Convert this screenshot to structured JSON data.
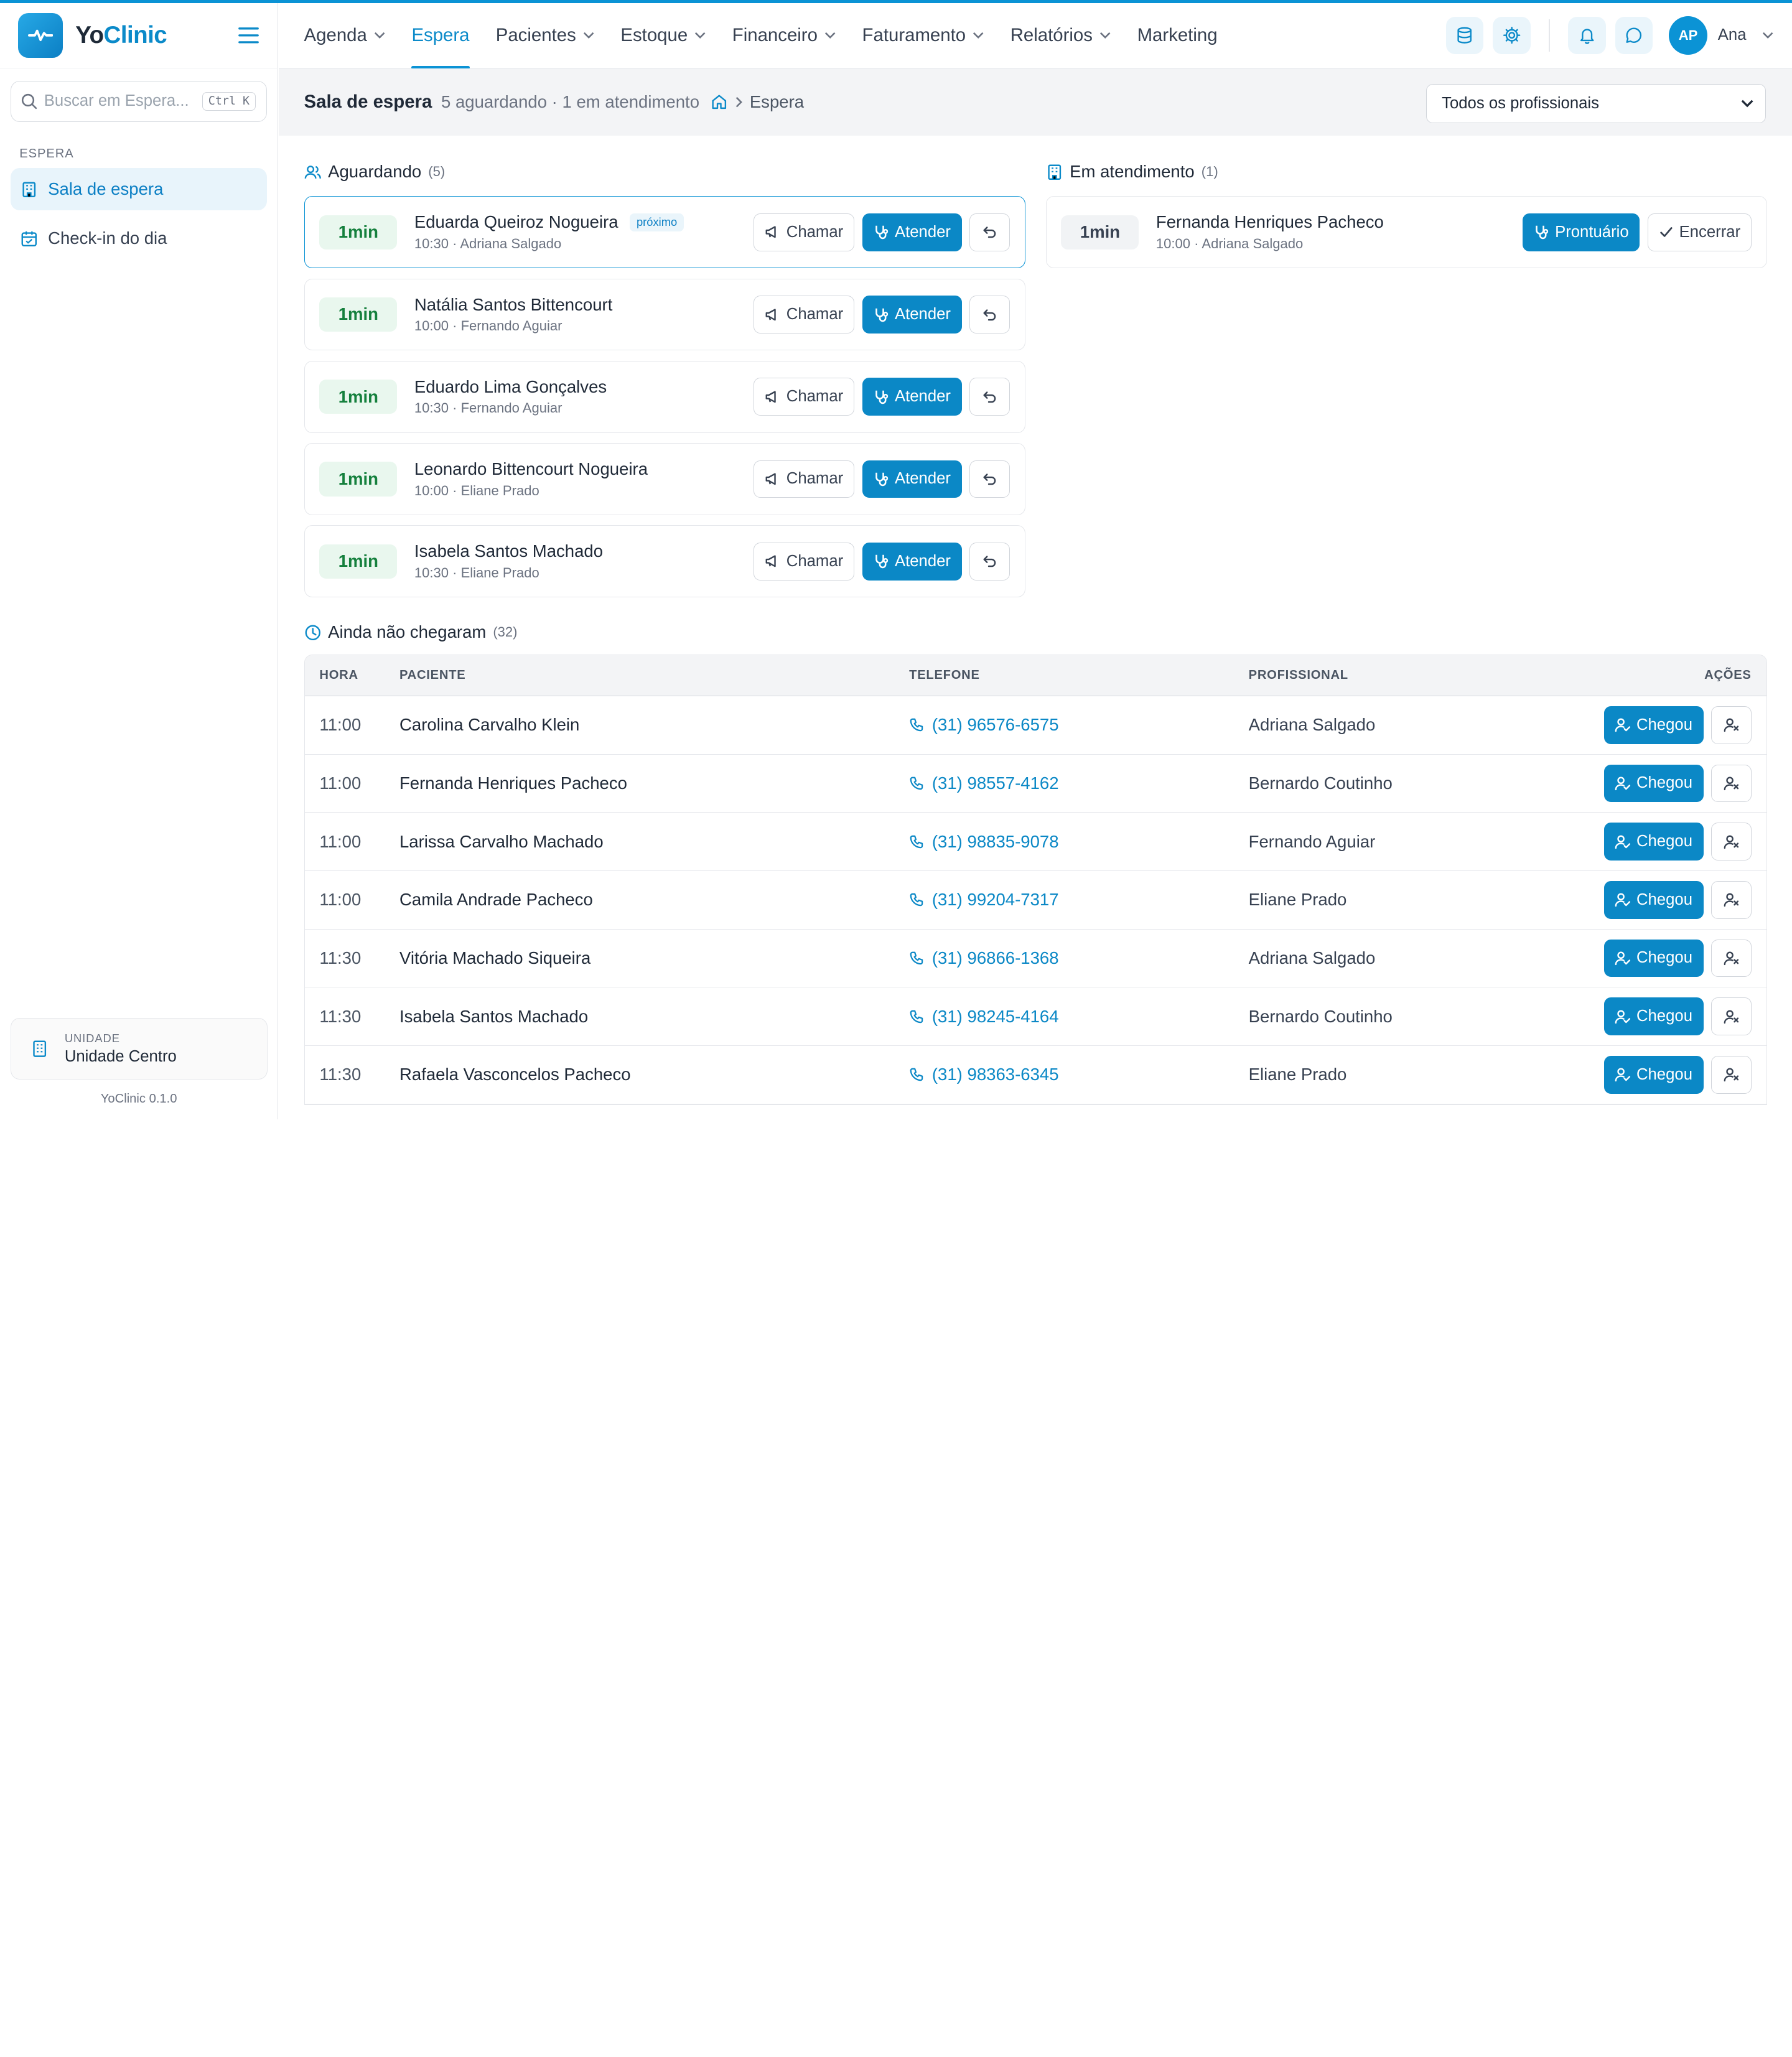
{
  "app": {
    "name_part1": "Yo",
    "name_part2": "Clinic",
    "version": "YoClinic 0.1.0"
  },
  "sidebar": {
    "search_placeholder": "Buscar em Espera...",
    "search_shortcut": "Ctrl K",
    "section_title": "ESPERA",
    "items": [
      {
        "label": "Sala de espera",
        "icon": "building-icon",
        "active": true
      },
      {
        "label": "Check-in do dia",
        "icon": "calendar-check-icon",
        "active": false
      }
    ],
    "unit_label": "UNIDADE",
    "unit_name": "Unidade Centro"
  },
  "nav": {
    "items": [
      {
        "label": "Agenda",
        "has_menu": true
      },
      {
        "label": "Espera",
        "has_menu": false,
        "active": true
      },
      {
        "label": "Pacientes",
        "has_menu": true
      },
      {
        "label": "Estoque",
        "has_menu": true
      },
      {
        "label": "Financeiro",
        "has_menu": true
      },
      {
        "label": "Faturamento",
        "has_menu": true
      },
      {
        "label": "Relatórios",
        "has_menu": true
      },
      {
        "label": "Marketing",
        "has_menu": false
      }
    ],
    "user_initials": "AP",
    "user_name": "Ana"
  },
  "subheader": {
    "title": "Sala de espera",
    "meta": "5 aguardando · 1 em atendimento",
    "breadcrumb_current": "Espera",
    "professional_filter": "Todos os profissionais"
  },
  "waiting": {
    "title": "Aguardando",
    "count": "(5)",
    "next_tag": "próximo",
    "btn_call": "Chamar",
    "btn_attend": "Atender",
    "items": [
      {
        "wait": "1min",
        "name": "Eduarda Queiroz Nogueira",
        "meta": "10:30 · Adriana Salgado",
        "next": true
      },
      {
        "wait": "1min",
        "name": "Natália Santos Bittencourt",
        "meta": "10:00 · Fernando Aguiar",
        "next": false
      },
      {
        "wait": "1min",
        "name": "Eduardo Lima Gonçalves",
        "meta": "10:30 · Fernando Aguiar",
        "next": false
      },
      {
        "wait": "1min",
        "name": "Leonardo Bittencourt Nogueira",
        "meta": "10:00 · Eliane Prado",
        "next": false
      },
      {
        "wait": "1min",
        "name": "Isabela Santos Machado",
        "meta": "10:30 · Eliane Prado",
        "next": false
      }
    ]
  },
  "in_service": {
    "title": "Em atendimento",
    "count": "(1)",
    "btn_record": "Prontuário",
    "btn_close": "Encerrar",
    "items": [
      {
        "wait": "1min",
        "name": "Fernanda Henriques Pacheco",
        "meta": "10:00 · Adriana Salgado"
      }
    ]
  },
  "not_arrived": {
    "title": "Ainda não chegaram",
    "count": "(32)",
    "columns": {
      "hora": "HORA",
      "paciente": "PACIENTE",
      "telefone": "TELEFONE",
      "profissional": "PROFISSIONAL",
      "acoes": "AÇÕES"
    },
    "btn_arrived": "Chegou",
    "rows": [
      {
        "hora": "11:00",
        "paciente": "Carolina Carvalho Klein",
        "telefone": "(31) 96576-6575",
        "profissional": "Adriana Salgado"
      },
      {
        "hora": "11:00",
        "paciente": "Fernanda Henriques Pacheco",
        "telefone": "(31) 98557-4162",
        "profissional": "Bernardo Coutinho"
      },
      {
        "hora": "11:00",
        "paciente": "Larissa Carvalho Machado",
        "telefone": "(31) 98835-9078",
        "profissional": "Fernando Aguiar"
      },
      {
        "hora": "11:00",
        "paciente": "Camila Andrade Pacheco",
        "telefone": "(31) 99204-7317",
        "profissional": "Eliane Prado"
      },
      {
        "hora": "11:30",
        "paciente": "Vitória Machado Siqueira",
        "telefone": "(31) 96866-1368",
        "profissional": "Adriana Salgado"
      },
      {
        "hora": "11:30",
        "paciente": "Isabela Santos Machado",
        "telefone": "(31) 98245-4164",
        "profissional": "Bernardo Coutinho"
      },
      {
        "hora": "11:30",
        "paciente": "Rafaela Vasconcelos Pacheco",
        "telefone": "(31) 98363-6345",
        "profissional": "Eliane Prado"
      }
    ]
  },
  "colors": {
    "primary": "#0b88c6",
    "accent": "#0b93d5",
    "success_bg": "#e9f7ee",
    "success_text": "#15803d"
  }
}
